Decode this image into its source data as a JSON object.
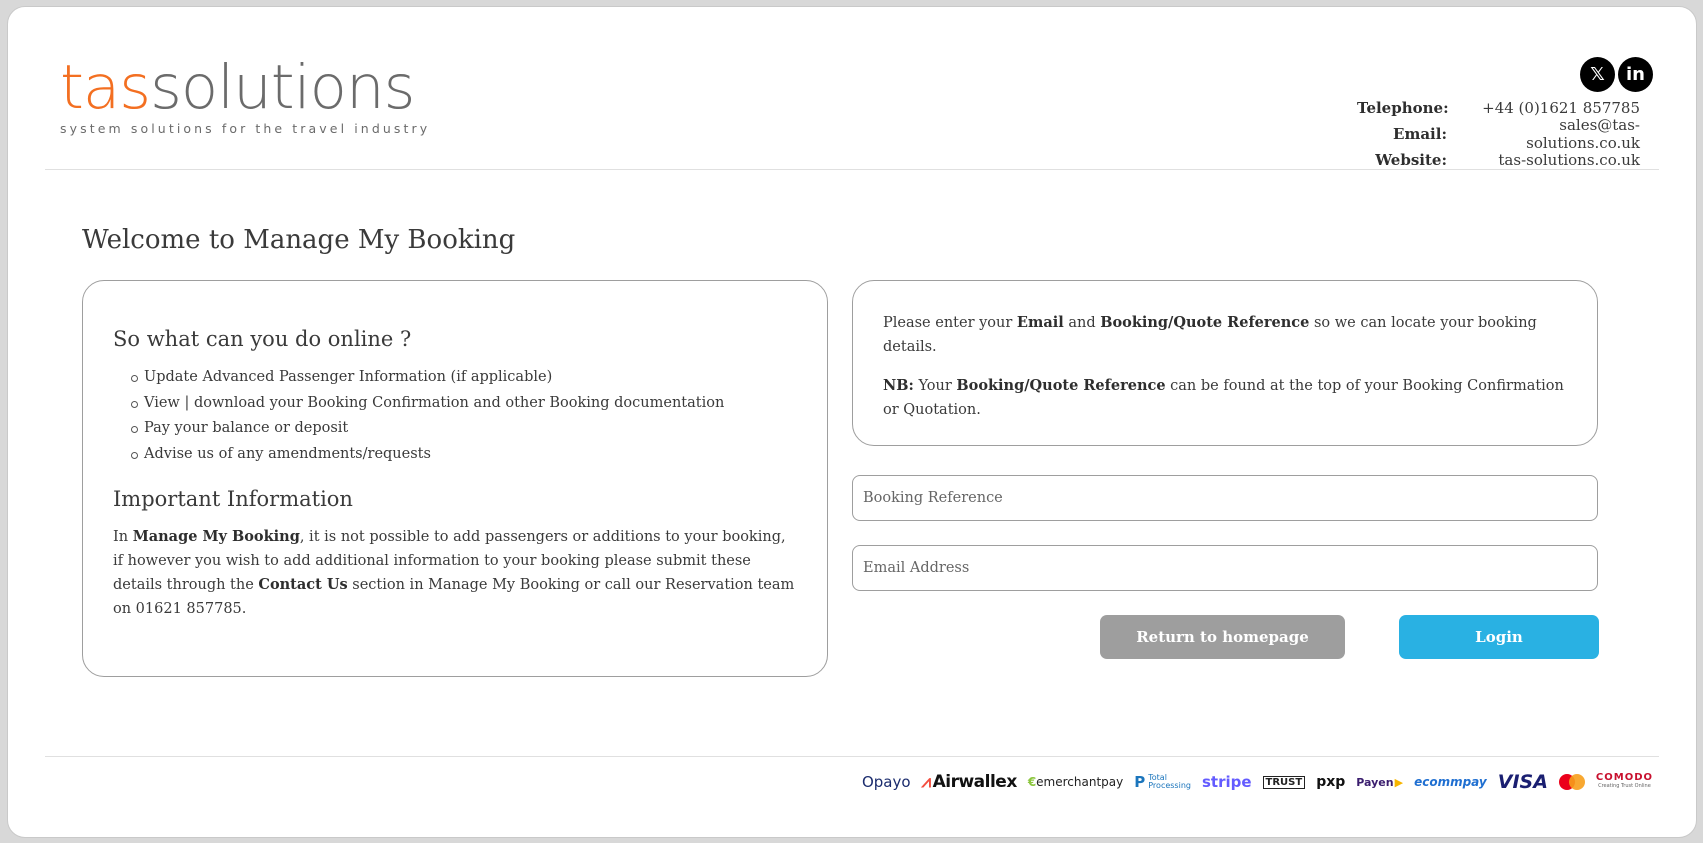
{
  "brand": {
    "logo_part1": "tas",
    "logo_part2": "solutions",
    "tagline": "system solutions for the travel industry"
  },
  "social": [
    {
      "label": "𝕏",
      "icon": "x-twitter-icon"
    },
    {
      "label": "in",
      "icon": "linkedin-icon"
    }
  ],
  "contact": {
    "telephone_label": "Telephone:",
    "telephone": "+44 (0)1621 857785",
    "email_label": "Email:",
    "email": "sales@tas-solutions.co.uk",
    "website_label": "Website:",
    "website": "tas-solutions.co.uk"
  },
  "page_title": "Welcome to Manage My Booking",
  "left_card": {
    "heading": "So what can you do online ?",
    "items": [
      "Update Advanced Passenger Information (if applicable)",
      "View | download your Booking Confirmation and other Booking documentation",
      "Pay your balance or deposit",
      "Advise us of any amendments/requests"
    ],
    "info_heading": "Important Information",
    "info_1": "In ",
    "info_bold_1": "Manage My Booking",
    "info_2": ", it is not possible to add passengers or additions to your booking, if however you wish to add additional information to your booking please submit these details through the ",
    "info_bold_2": "Contact Us",
    "info_3": " section in Manage My Booking or call our Reservation team on 01621 857785."
  },
  "right_card": {
    "p1_a": "Please enter your ",
    "p1_b1": "Email",
    "p1_c": " and ",
    "p1_b2": "Booking/Quote Reference",
    "p1_d": " so we can locate your booking details.",
    "p2_b1": "NB:",
    "p2_a": " Your ",
    "p2_b2": "Booking/Quote Reference",
    "p2_c": " can be found at the top of your Booking Confirmation or Quotation."
  },
  "form": {
    "booking_ref_placeholder": "Booking Reference",
    "email_placeholder": "Email Address",
    "return_label": "Return to homepage",
    "login_label": "Login"
  },
  "payments": {
    "opayo": "Opayo",
    "airwallex": "Airwallex",
    "emerchantpay": "emerchantpay",
    "total_line1": "Total",
    "total_line2": "Processing",
    "stripe": "stripe",
    "trust": "TRUST",
    "pxp": "pxp",
    "payen": "Payen",
    "ecommpay": "ecommpay",
    "visa": "VISA",
    "comodo": "COMODO",
    "comodo_sub": "Creating Trust Online"
  },
  "colors": {
    "brand_orange": "#f36f21",
    "brand_grey": "#6b6b6b",
    "login_blue": "#29b1e3",
    "return_grey": "#9e9e9e"
  }
}
